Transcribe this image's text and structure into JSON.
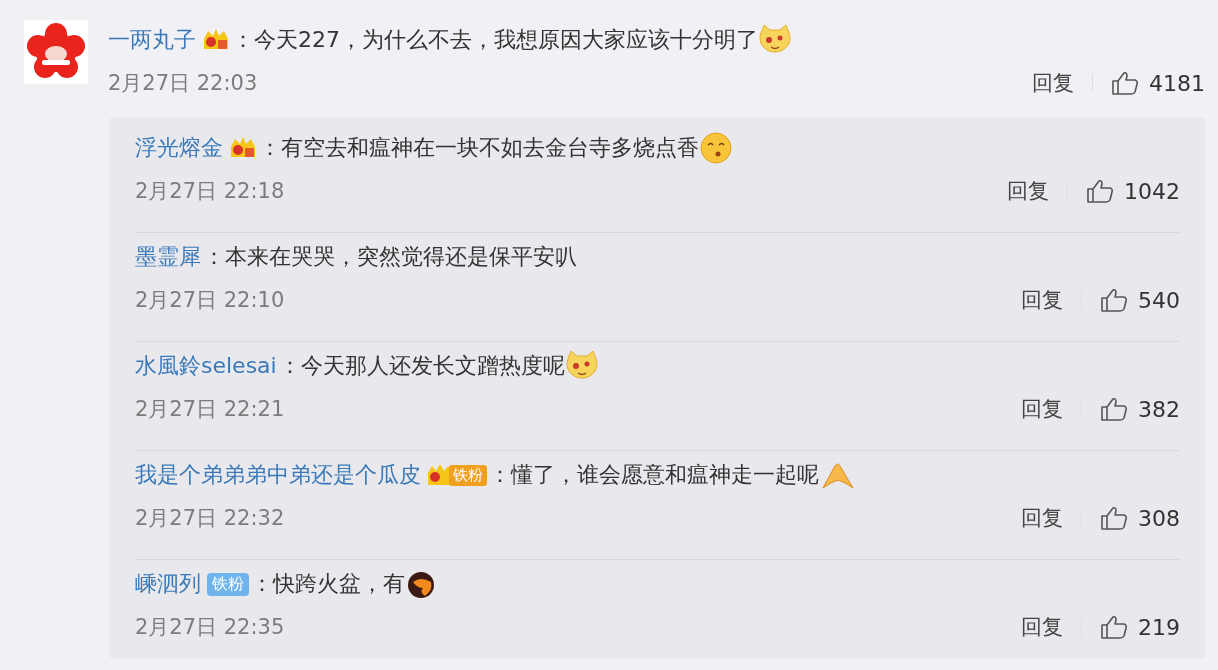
{
  "comment": {
    "user": "一两丸子",
    "badge": {
      "kind": "crown"
    },
    "text": "：今天227，为什么不去，我想原因大家应该十分明了",
    "emoji": {
      "kind": "doge"
    },
    "time": "2月27日 22:03",
    "reply_label": "回复",
    "likes": "4181"
  },
  "replies": [
    {
      "user": "浮光熔金",
      "badge": {
        "kind": "crown"
      },
      "text": "：有空去和瘟神在一块不如去金台寺多烧点香",
      "emoji": {
        "kind": "kiss"
      },
      "time": "2月27日 22:18",
      "reply_label": "回复",
      "likes": "1042"
    },
    {
      "user": "墨霊犀",
      "text": "：本来在哭哭，突然觉得还是保平安叭",
      "time": "2月27日 22:10",
      "reply_label": "回复",
      "likes": "540"
    },
    {
      "user": "水風鈴selesai",
      "text": "：今天那人还发长文蹭热度呢",
      "emoji": {
        "kind": "doge"
      },
      "time": "2月27日 22:21",
      "reply_label": "回复",
      "likes": "382"
    },
    {
      "user": "我是个弟弟弟中弟还是个瓜皮",
      "badge": {
        "kind": "crown-fan",
        "label": "铁粉"
      },
      "text": "：懂了，谁会愿意和瘟神走一起呢",
      "emoji": {
        "kind": "pray"
      },
      "time": "2月27日 22:32",
      "reply_label": "回复",
      "likes": "308"
    },
    {
      "user": "嵊泗列",
      "badge": {
        "kind": "fan",
        "label": "铁粉"
      },
      "text": "：快跨火盆，有",
      "emoji": {
        "kind": "fire"
      },
      "time": "2月27日 22:35",
      "reply_label": "回复",
      "likes": "219"
    }
  ]
}
